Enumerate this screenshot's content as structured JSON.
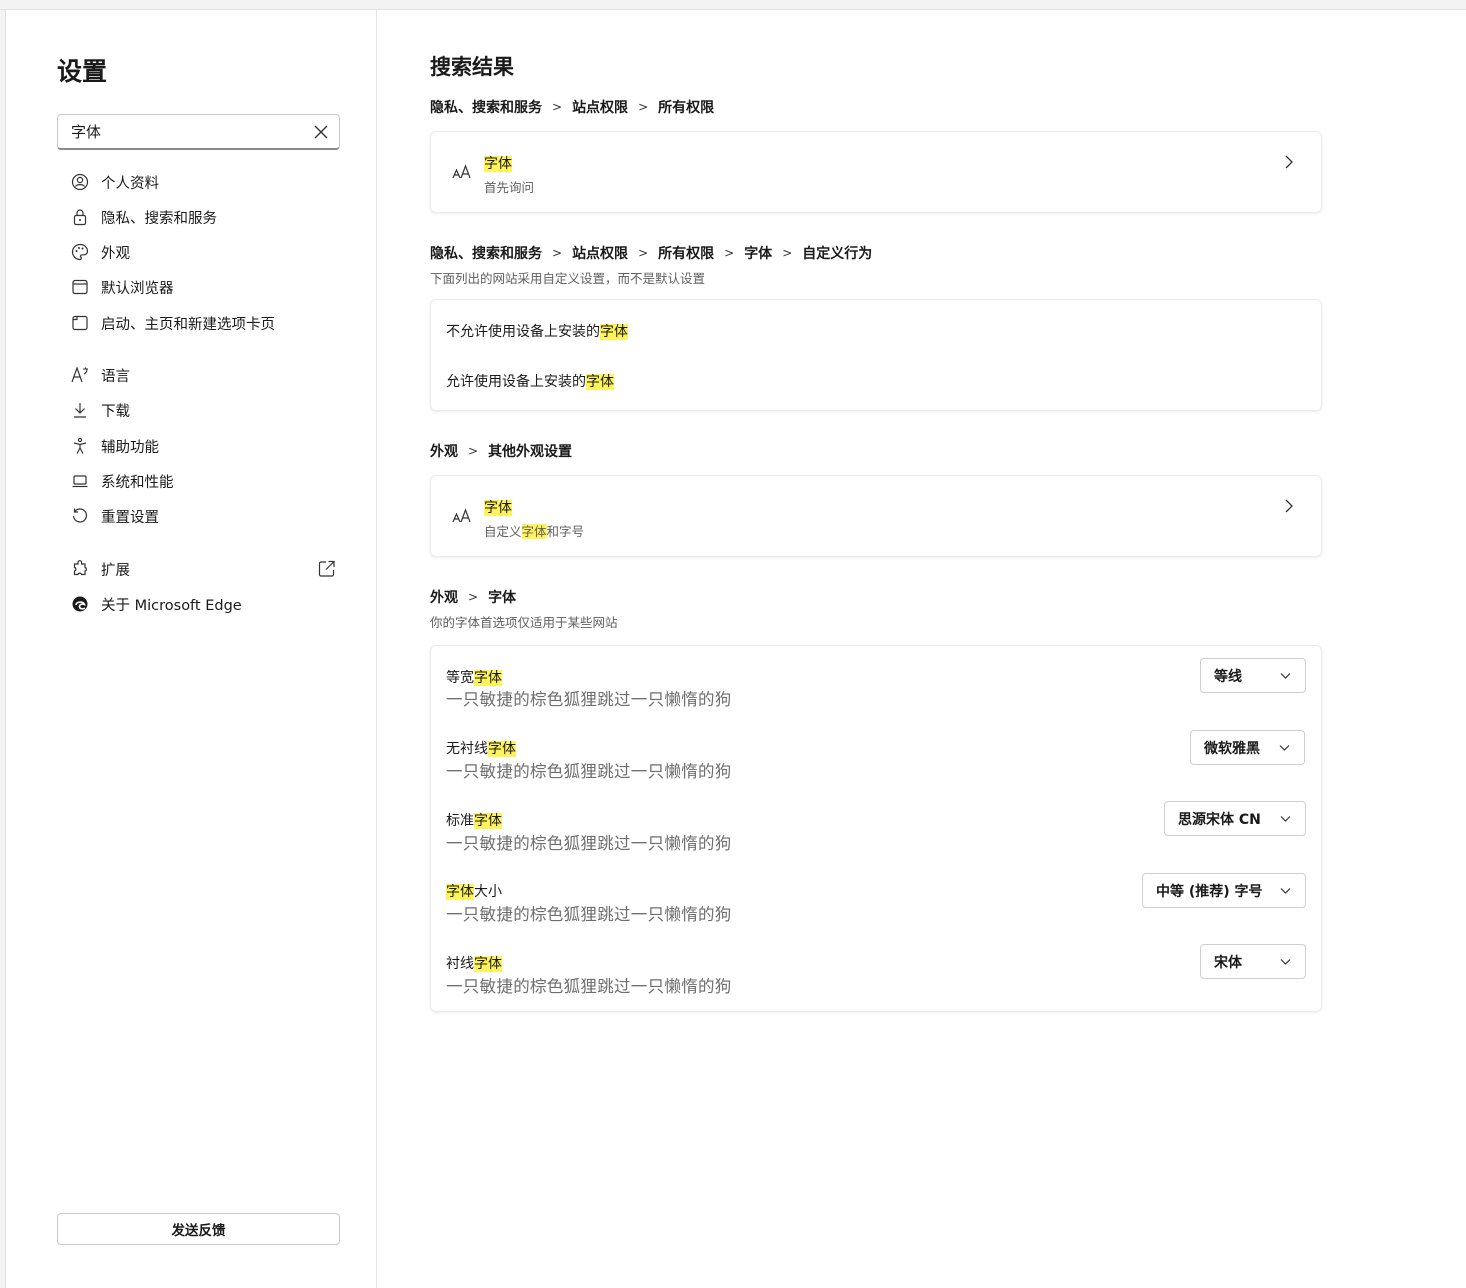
{
  "sidebar": {
    "title": "设置",
    "search": {
      "value": "字体",
      "placeholder": ""
    },
    "items": [
      {
        "label": "个人资料",
        "icon": "profile-icon"
      },
      {
        "label": "隐私、搜索和服务",
        "icon": "lock-icon"
      },
      {
        "label": "外观",
        "icon": "palette-icon"
      },
      {
        "label": "默认浏览器",
        "icon": "browser-icon"
      },
      {
        "label": "启动、主页和新建选项卡页",
        "icon": "home-icon"
      },
      {
        "label": "语言",
        "icon": "language-icon"
      },
      {
        "label": "下载",
        "icon": "download-icon"
      },
      {
        "label": "辅助功能",
        "icon": "accessibility-icon"
      },
      {
        "label": "系统和性能",
        "icon": "laptop-icon"
      },
      {
        "label": "重置设置",
        "icon": "reset-icon"
      },
      {
        "label": "扩展",
        "icon": "extension-icon"
      },
      {
        "label": "关于 Microsoft Edge",
        "icon": "edge-icon"
      }
    ],
    "feedback_label": "发送反馈"
  },
  "main": {
    "title": "搜索结果",
    "section1": {
      "crumbs": [
        "隐私、搜索和服务",
        "站点权限",
        "所有权限"
      ],
      "item": {
        "title": "字体",
        "subtitle": "首先询问"
      }
    },
    "section2": {
      "crumbs": [
        "隐私、搜索和服务",
        "站点权限",
        "所有权限",
        "字体",
        "自定义行为"
      ],
      "description": "下面列出的网站采用自定义设置，而不是默认设置",
      "rows": [
        {
          "prefix": "不允许使用设备上安装的",
          "highlight": "字体"
        },
        {
          "prefix": "允许使用设备上安装的",
          "highlight": "字体"
        }
      ]
    },
    "section3": {
      "crumbs": [
        "外观",
        "其他外观设置"
      ],
      "item": {
        "title": "字体",
        "subtitle_prefix": "自定义",
        "subtitle_highlight": "字体",
        "subtitle_suffix": "和字号"
      }
    },
    "section4": {
      "crumbs": [
        "外观",
        "字体"
      ],
      "description": "你的字体首选项仅适用于某些网站",
      "rows": [
        {
          "prefix": "等宽",
          "highlight": "字体",
          "suffix": "",
          "sample": "一只敏捷的棕色狐狸跳过一只懒惰的狗",
          "select": "等线"
        },
        {
          "prefix": "无衬线",
          "highlight": "字体",
          "suffix": "",
          "sample": "一只敏捷的棕色狐狸跳过一只懒惰的狗",
          "select": "微软雅黑"
        },
        {
          "prefix": "标准",
          "highlight": "字体",
          "suffix": "",
          "sample": "一只敏捷的棕色狐狸跳过一只懒惰的狗",
          "select": "思源宋体 CN"
        },
        {
          "prefix": "",
          "highlight": "字体",
          "suffix": "大小",
          "sample": "一只敏捷的棕色狐狸跳过一只懒惰的狗",
          "select": "中等 (推荐) 字号"
        },
        {
          "prefix": "衬线",
          "highlight": "字体",
          "suffix": "",
          "sample": "一只敏捷的棕色狐狸跳过一只懒惰的狗",
          "select": "宋体"
        }
      ]
    }
  },
  "colors": {
    "highlight": "#fff35b",
    "edge_brand": "#0c59a4"
  }
}
